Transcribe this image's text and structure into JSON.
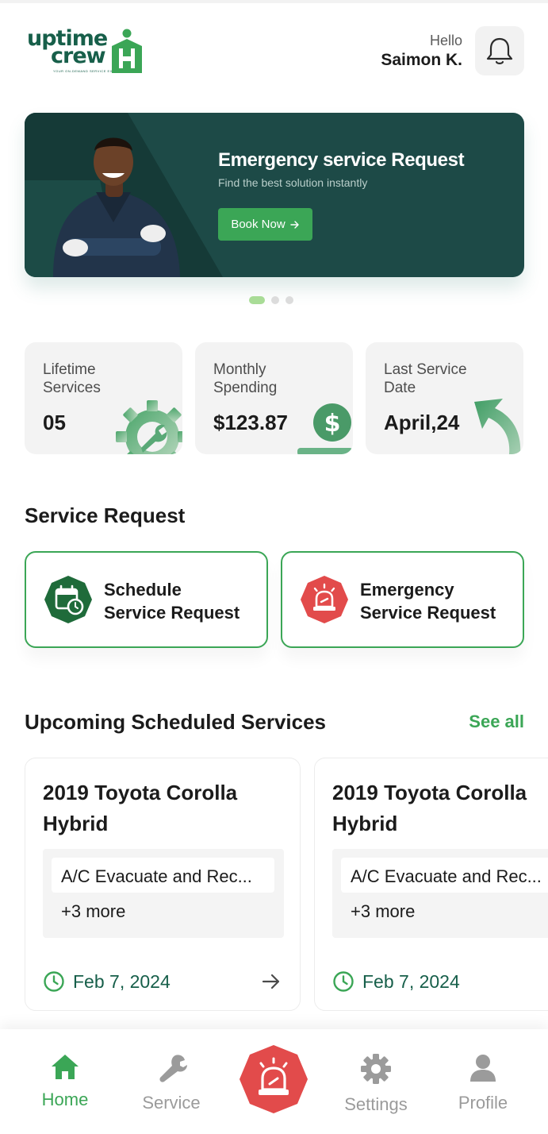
{
  "app": {
    "logo_line1": "uptime",
    "logo_line2": "crew",
    "logo_tagline": "YOUR ON-DEMAND SERVICE EXPERTS"
  },
  "header": {
    "greeting": "Hello",
    "user_name": "Saimon K.",
    "bell_icon": "bell-icon"
  },
  "banner": {
    "title": "Emergency service Request",
    "subtitle": "Find the best solution instantly",
    "button_label": "Book Now",
    "button_icon": "arrow-right-icon",
    "dots_total": 3,
    "active_dot": 0
  },
  "stats": [
    {
      "label": "Lifetime Services",
      "value": "05",
      "icon": "gear-wrench-icon"
    },
    {
      "label": "Monthly Spending",
      "value": "$123.87",
      "icon": "dollar-coin-icon"
    },
    {
      "label": "Last Service Date",
      "value": "April,24",
      "icon": "return-arrow-icon"
    }
  ],
  "service_request": {
    "title": "Service Request",
    "items": [
      {
        "label_line1": "Schedule",
        "label_line2": "Service Request",
        "icon": "calendar-clock-icon",
        "icon_color": "#1f6b3a"
      },
      {
        "label_line1": "Emergency",
        "label_line2": "Service Request",
        "icon": "siren-icon",
        "icon_color": "#e24b4b"
      }
    ]
  },
  "upcoming": {
    "title": "Upcoming Scheduled Services",
    "see_all": "See all",
    "cards": [
      {
        "vehicle": "2019 Toyota Corolla Hybrid",
        "service": "A/C Evacuate and Rec...",
        "more": "+3 more",
        "date": "Feb 7, 2024"
      },
      {
        "vehicle": "2019 Toyota Corolla Hybrid",
        "service": "A/C Evacuate and Rec...",
        "more": "+3 more",
        "date": "Feb 7, 2024"
      }
    ]
  },
  "nav": {
    "items": [
      {
        "label": "Home",
        "icon": "home-icon",
        "active": true
      },
      {
        "label": "Service",
        "icon": "wrench-icon",
        "active": false
      },
      {
        "label": "Settings",
        "icon": "gear-icon",
        "active": false
      },
      {
        "label": "Profile",
        "icon": "person-icon",
        "active": false
      }
    ],
    "center_icon": "siren-icon"
  },
  "colors": {
    "brand_green": "#3ba656",
    "dark_green": "#175f4a",
    "banner_bg": "#1d4a47",
    "emergency_red": "#e24b4b"
  }
}
